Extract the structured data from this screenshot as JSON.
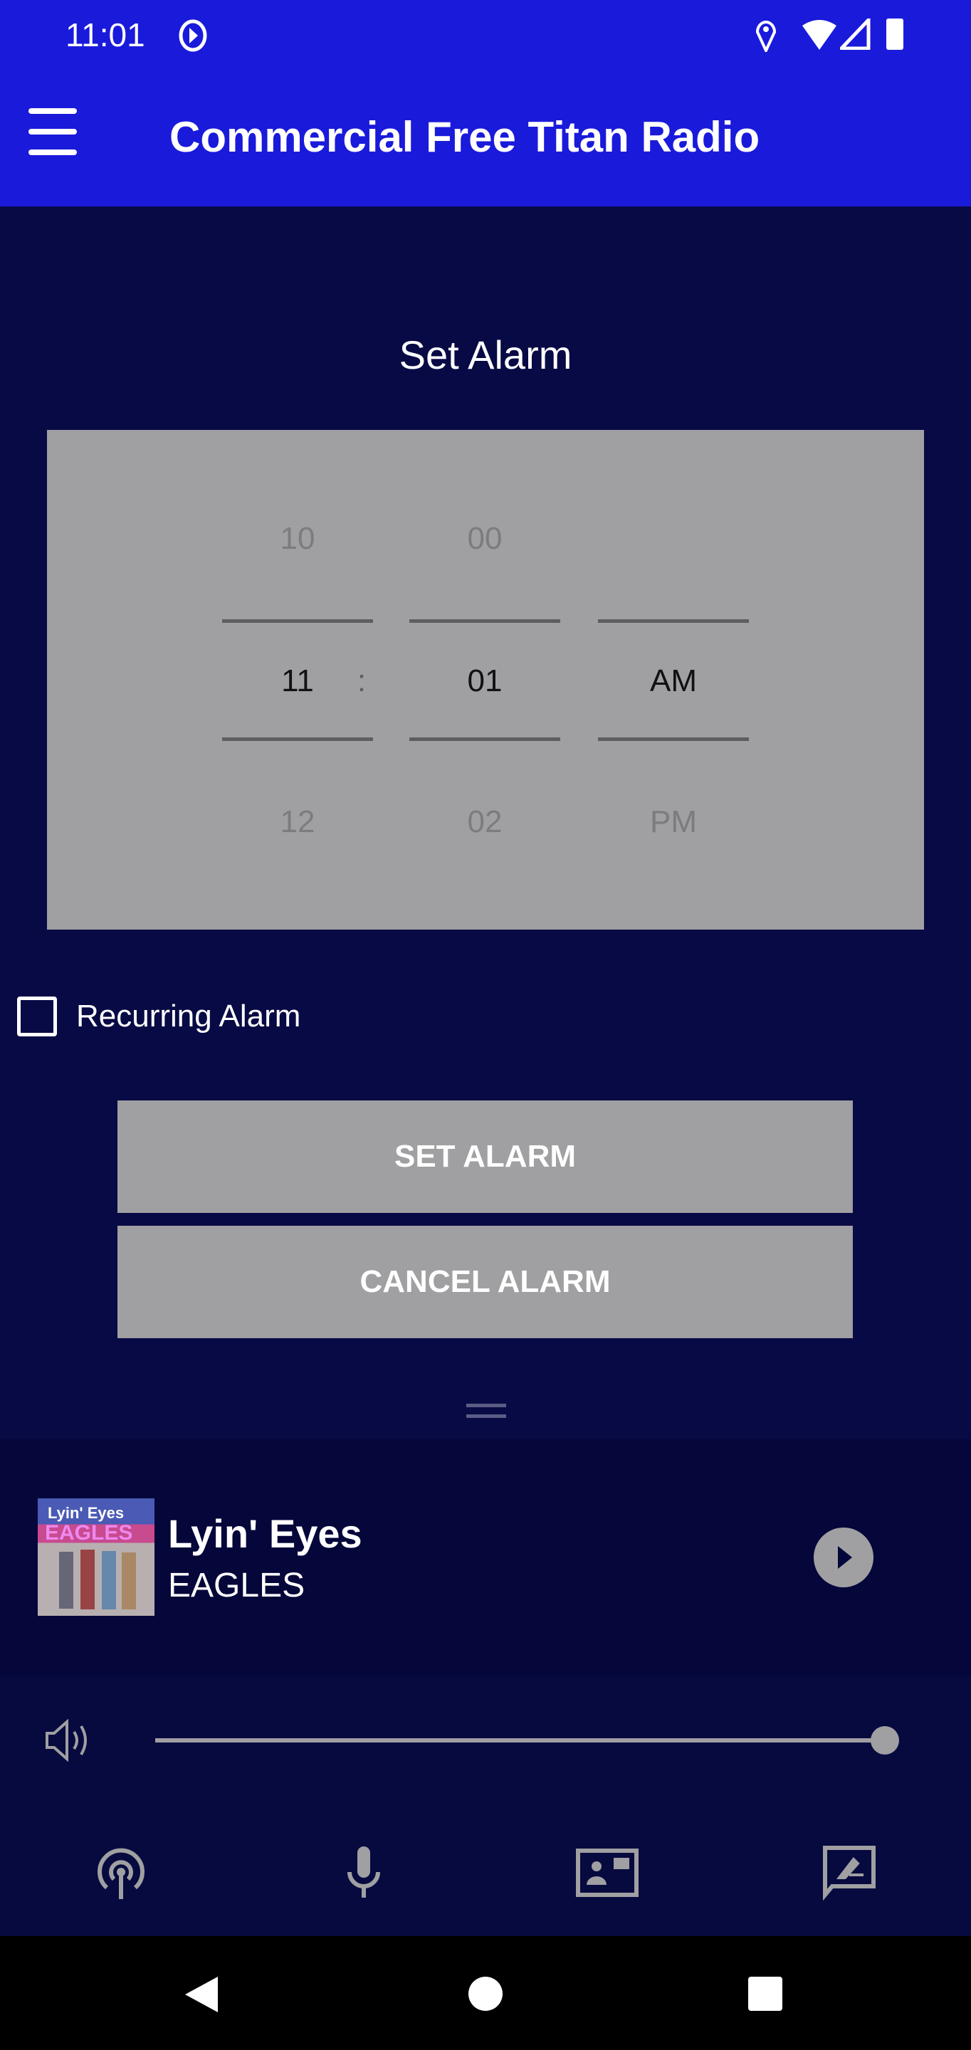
{
  "status_bar": {
    "time": "11:01",
    "icons": [
      "play-circle-icon",
      "location-icon",
      "wifi-icon",
      "signal-icon",
      "battery-icon"
    ]
  },
  "app_bar": {
    "title": "Commercial Free Titan Radio",
    "menu_icon": "hamburger-icon"
  },
  "alarm": {
    "title": "Set Alarm",
    "picker": {
      "hours": [
        "10",
        "11",
        "12"
      ],
      "minutes": [
        "00",
        "01",
        "02"
      ],
      "ampm": [
        "",
        "AM",
        "PM"
      ],
      "separator": ":",
      "selected": {
        "hour": "11",
        "minute": "01",
        "ampm": "AM"
      }
    },
    "recurring_label": "Recurring Alarm",
    "recurring_checked": false,
    "set_label": "SET ALARM",
    "cancel_label": "CANCEL ALARM"
  },
  "player": {
    "song": "Lyin' Eyes",
    "artist": "EAGLES",
    "album_art_text": "Lyin' Eyes EAGLES",
    "volume": 1.0
  },
  "bottom_nav": [
    "podcast-icon",
    "microphone-icon",
    "contact-mail-icon",
    "feedback-icon"
  ],
  "colors": {
    "header": "#1a1adb",
    "background": "#080a45",
    "accent_gray": "#a09fa2"
  }
}
